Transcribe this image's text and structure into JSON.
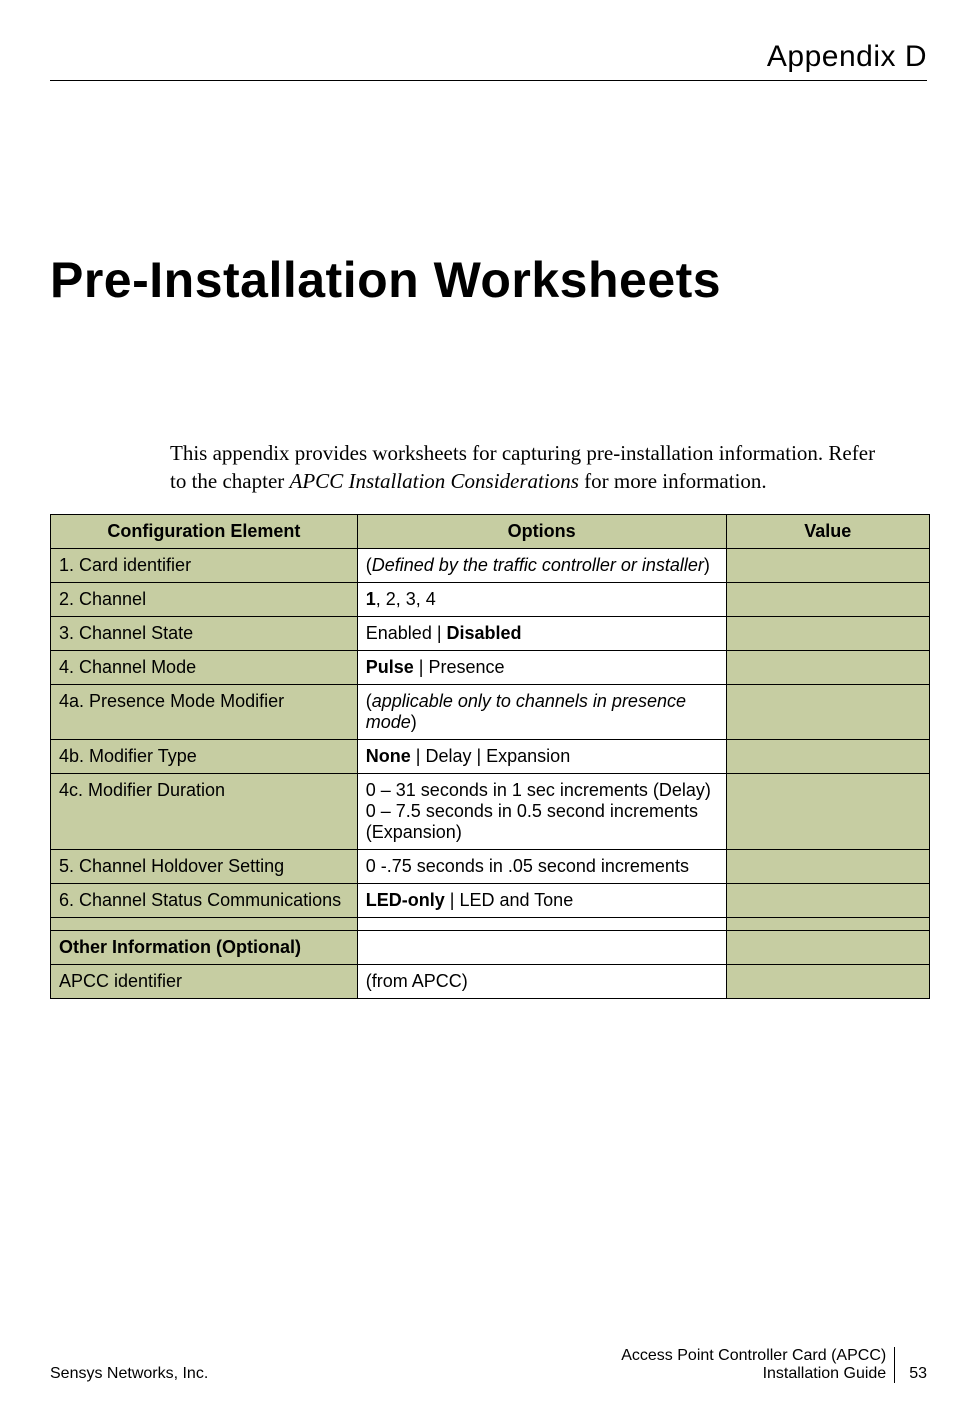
{
  "header": {
    "appendix": "Appendix D"
  },
  "title": "Pre-Installation Worksheets",
  "intro_parts": {
    "p1": "This appendix provides worksheets for capturing pre-installation information. Refer to the chapter ",
    "ital": "APCC Installation Considerations",
    "p2": " for more information."
  },
  "table": {
    "headers": {
      "c1": "Configuration Element",
      "c2": "Options",
      "c3": "Value"
    },
    "rows": [
      {
        "elem": "1. Card identifier",
        "opt_html": "(<i>Defined by the traffic controller or installer</i>)",
        "val": ""
      },
      {
        "elem": "2. Channel",
        "opt_html": "<span class=\"b\">1</span>, 2, 3, 4",
        "val": ""
      },
      {
        "elem": "3. Channel State",
        "opt_html": "Enabled | <span class=\"b\">Disabled</span>",
        "val": ""
      },
      {
        "elem": "4. Channel Mode",
        "opt_html": "<span class=\"b\">Pulse</span> | Presence",
        "val": ""
      },
      {
        "elem": "4a. Presence Mode Modifier",
        "opt_html": "(<i>applicable only to channels in presence mode</i>)",
        "val": ""
      },
      {
        "elem": "4b. Modifier Type",
        "opt_html": "<span class=\"b\">None</span> | Delay | Expansion",
        "val": ""
      },
      {
        "elem": "4c. Modifier Duration",
        "opt_html": "0 – 31 seconds in 1 sec increments (Delay)<br>0 – 7.5 seconds in 0.5 second increments (Expansion)",
        "val": ""
      },
      {
        "elem": "5. Channel Holdover Setting",
        "opt_html": "0 -.75 seconds in .05 second increments",
        "val": ""
      },
      {
        "elem": "6. Channel Status Communications",
        "opt_html": "<span class=\"b\">LED-only</span> | LED and Tone",
        "val": ""
      },
      {
        "elem": "",
        "opt_html": "",
        "val": ""
      },
      {
        "elem_html": "<span class=\"b\">Other Information (Optional)</span>",
        "opt_html": "",
        "val": ""
      },
      {
        "elem": "APCC identifier",
        "opt_html": "(from APCC)",
        "val": ""
      }
    ]
  },
  "footer": {
    "left": "Sensys Networks, Inc.",
    "right_line1": "Access Point Controller Card (APCC)",
    "right_line2": "Installation Guide",
    "page_number": "53"
  }
}
